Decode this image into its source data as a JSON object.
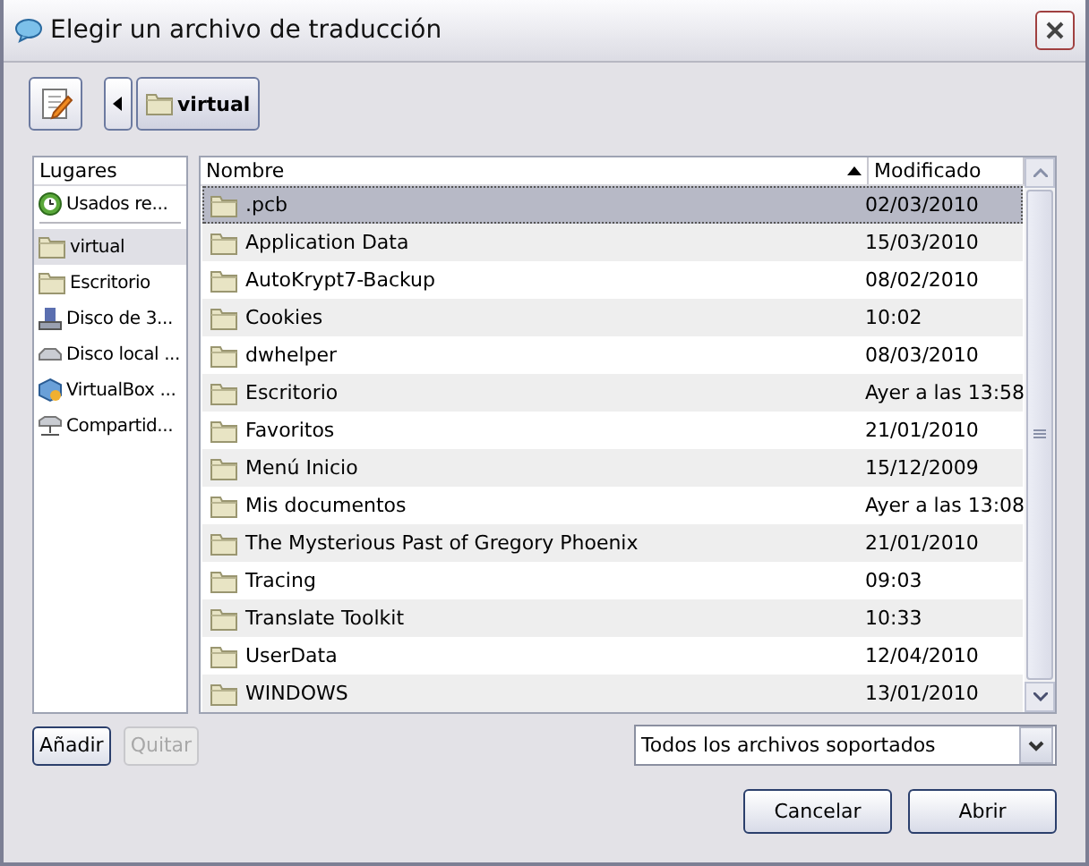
{
  "window": {
    "title": "Elegir un archivo de traducción"
  },
  "path_bar": {
    "segments": [
      {
        "label": "virtual",
        "selected": true
      }
    ]
  },
  "sidebar": {
    "header": "Lugares",
    "items": [
      {
        "label": "Usados re...",
        "kind": "recent",
        "selected": false,
        "separator_after": true
      },
      {
        "label": "virtual",
        "kind": "folder",
        "selected": true,
        "separator_after": false
      },
      {
        "label": "Escritorio",
        "kind": "folder",
        "selected": false,
        "separator_after": false
      },
      {
        "label": "Disco de 3...",
        "kind": "floppy",
        "selected": false,
        "separator_after": false
      },
      {
        "label": "Disco local ...",
        "kind": "disk",
        "selected": false,
        "separator_after": false
      },
      {
        "label": "VirtualBox ...",
        "kind": "vbox",
        "selected": false,
        "separator_after": false
      },
      {
        "label": "Compartid...",
        "kind": "network",
        "selected": false,
        "separator_after": false
      }
    ]
  },
  "table": {
    "columns": [
      "Nombre",
      "Modificado"
    ],
    "rows": [
      {
        "name": ".pcb",
        "modified": "02/03/2010",
        "selected": true
      },
      {
        "name": "Application Data",
        "modified": "15/03/2010",
        "selected": false
      },
      {
        "name": "AutoKrypt7-Backup",
        "modified": "08/02/2010",
        "selected": false
      },
      {
        "name": "Cookies",
        "modified": "10:02",
        "selected": false
      },
      {
        "name": "dwhelper",
        "modified": "08/03/2010",
        "selected": false
      },
      {
        "name": "Escritorio",
        "modified": "Ayer a las 13:58",
        "selected": false
      },
      {
        "name": "Favoritos",
        "modified": "21/01/2010",
        "selected": false
      },
      {
        "name": "Menú Inicio",
        "modified": "15/12/2009",
        "selected": false
      },
      {
        "name": "Mis documentos",
        "modified": "Ayer a las 13:08",
        "selected": false
      },
      {
        "name": "The Mysterious Past of Gregory Phoenix",
        "modified": "21/01/2010",
        "selected": false
      },
      {
        "name": "Tracing",
        "modified": "09:03",
        "selected": false
      },
      {
        "name": "Translate Toolkit",
        "modified": "10:33",
        "selected": false
      },
      {
        "name": "UserData",
        "modified": "12/04/2010",
        "selected": false
      },
      {
        "name": "WINDOWS",
        "modified": "13/01/2010",
        "selected": false
      }
    ]
  },
  "sidebar_buttons": [
    {
      "label": "Añadir",
      "disabled": false
    },
    {
      "label": "Quitar",
      "disabled": true
    }
  ],
  "filter": {
    "value": "Todos los archivos soportados"
  },
  "buttons": [
    "Cancelar",
    "Abrir"
  ]
}
